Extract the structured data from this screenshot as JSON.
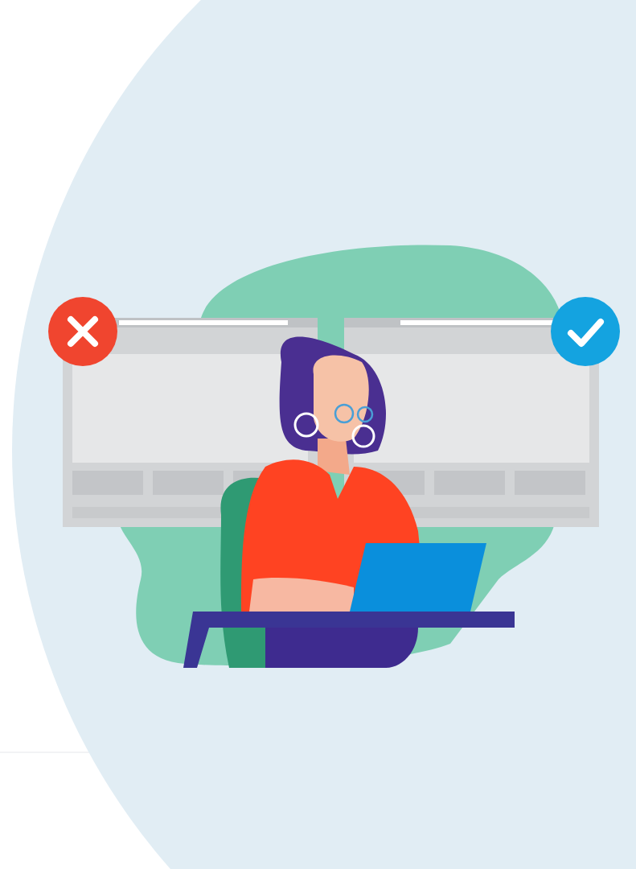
{
  "browser_windows": [
    {
      "kind": "rejected"
    },
    {
      "kind": "approved"
    }
  ]
}
